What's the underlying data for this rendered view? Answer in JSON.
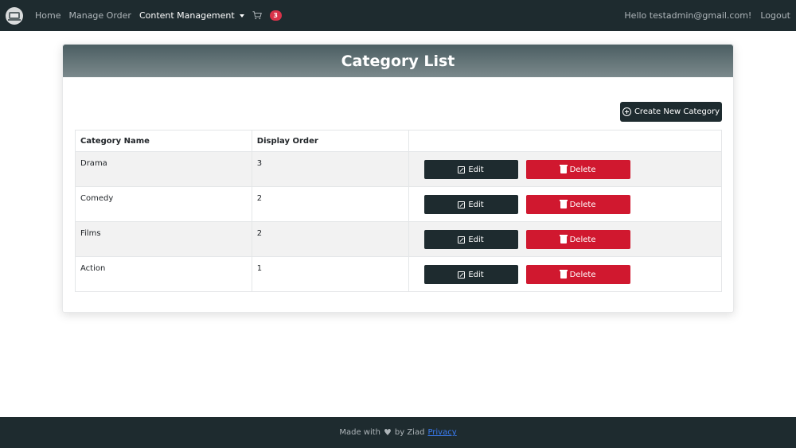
{
  "nav": {
    "home": "Home",
    "manage_order": "Manage Order",
    "content_management": "Content Management",
    "cart_count": "3",
    "greeting": "Hello testadmin@gmail.com!",
    "logout": "Logout"
  },
  "card": {
    "title": "Category List",
    "create_button": "Create New Category"
  },
  "table": {
    "headers": [
      "Category Name",
      "Display Order",
      ""
    ],
    "rows": [
      {
        "name": "Drama",
        "order": "3",
        "edit": "Edit",
        "delete": "Delete"
      },
      {
        "name": "Comedy",
        "order": "2",
        "edit": "Edit",
        "delete": "Delete"
      },
      {
        "name": "Films",
        "order": "2",
        "edit": "Edit",
        "delete": "Delete"
      },
      {
        "name": "Action",
        "order": "1",
        "edit": "Edit",
        "delete": "Delete"
      }
    ]
  },
  "footer": {
    "made_with": "Made with",
    "heart_icon": "heart-icon",
    "by": "by Ziad",
    "privacy": "Privacy"
  },
  "colors": {
    "navbar": "#1e2b2f",
    "danger": "#d0182f",
    "badge": "#d9334a",
    "link": "#3a7cf3"
  }
}
